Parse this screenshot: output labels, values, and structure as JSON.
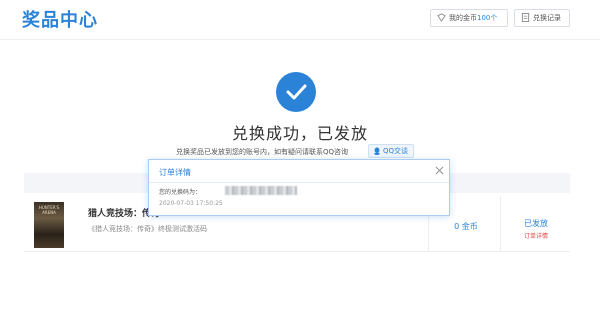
{
  "header": {
    "brand": "奖品中心",
    "coins_label": "我的金币",
    "coins_value": "100个",
    "records_label": "兑换记录"
  },
  "result": {
    "title": "兑换成功，已发放",
    "notice": "兑换奖品已发放到您的账号内，如有疑问请联系QQ咨询",
    "qq_button": "QQ交谈"
  },
  "order": {
    "cover_text": "HUNTER'S ARENA",
    "product_title": "猎人竞技场：传奇",
    "description": "《猎人竞技场：传奇》终极测试激活码",
    "price": "0 金币",
    "status": "已发放",
    "detail_link": "订单详情"
  },
  "popup": {
    "title": "订单详情",
    "code_label": "您的兑换码为：",
    "time": "2020-07-03 17:50:25"
  },
  "colors": {
    "accent": "#2b83d8",
    "danger": "#e04545"
  }
}
